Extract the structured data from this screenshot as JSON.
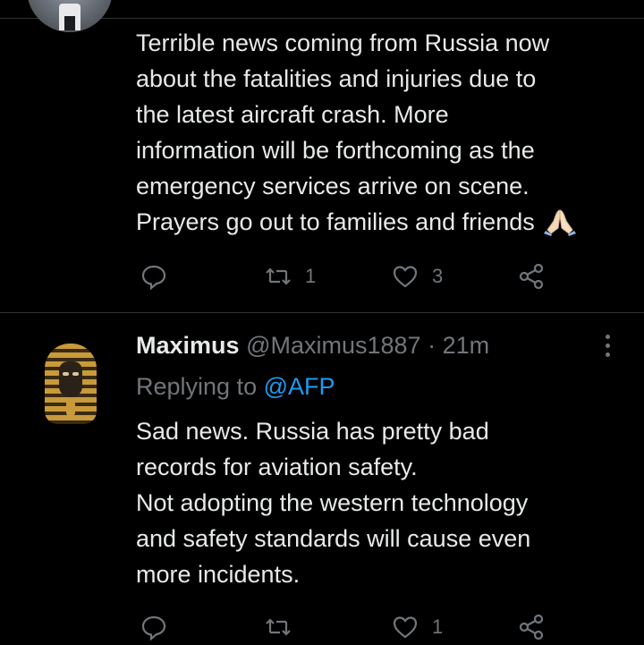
{
  "tweet1": {
    "text": "Terrible news coming from Russia now\nabout the fatalities and injuries due to\nthe latest aircraft crash. More\ninformation will be forthcoming as the\nemergency services arrive on scene.\nPrayers go out to families and friends",
    "emoji": "folded-hands",
    "retweet_count": "1",
    "like_count": "3"
  },
  "tweet2": {
    "name": "Maximus",
    "handle": "@Maximus1887",
    "separator": "·",
    "time": "21m",
    "replying_prefix": "Replying to",
    "replying_to": "@AFP",
    "text": "Sad news. Russia has pretty bad\nrecords for aviation safety.\nNot adopting the western technology\nand safety standards will cause even\nmore incidents.",
    "like_count": "1"
  },
  "icons": [
    "reply-icon",
    "retweet-icon",
    "like-icon",
    "share-icon",
    "more-icon"
  ],
  "colors": {
    "background": "#000000",
    "text": "#e7e9ea",
    "secondary": "#71767b",
    "link": "#1d9bf0",
    "divider": "#2f3336"
  }
}
